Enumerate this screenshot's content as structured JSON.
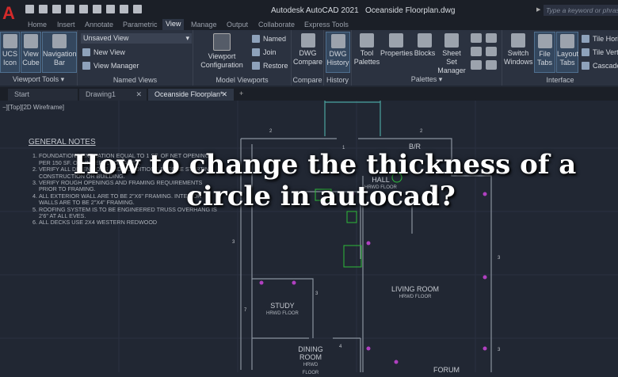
{
  "app": {
    "title": "Autodesk AutoCAD 2021",
    "file": "Oceanside Floorplan.dwg",
    "search_placeholder": "Type a keyword or phrase",
    "logo": "A"
  },
  "menu_tabs": [
    "Home",
    "Insert",
    "Annotate",
    "Parametric",
    "View",
    "Manage",
    "Output",
    "Collaborate",
    "Express Tools"
  ],
  "active_tab": "View",
  "ribbon": {
    "viewport_tools": {
      "label": "Viewport Tools ▾",
      "ucs": "UCS Icon",
      "cube": "View Cube",
      "nav": "Navigation Bar"
    },
    "named_views": {
      "label": "Named Views",
      "dropdown": "Unsaved View",
      "new_view": "New View",
      "view_manager": "View Manager"
    },
    "model_viewports": {
      "label": "Model Viewports",
      "config": "Viewport Configuration",
      "named": "Named",
      "join": "Join",
      "restore": "Restore"
    },
    "compare": {
      "label": "Compare",
      "btn": "DWG Compare"
    },
    "history": {
      "label": "History",
      "btn": "DWG History"
    },
    "palettes": {
      "label": "Palettes ▾",
      "tool": "Tool Palettes",
      "properties": "Properties",
      "blocks": "Blocks",
      "sheetset": "Sheet Set Manager"
    },
    "interface": {
      "label": "Interface",
      "switch": "Switch Windows",
      "file_tabs": "File Tabs",
      "layout_tabs": "Layout Tabs",
      "tile_h": "Tile Horizontally",
      "tile_v": "Tile Vertically",
      "cascade": "Cascade"
    }
  },
  "file_tabs": [
    "Start",
    "Drawing1",
    "Oceanside Floorplan*"
  ],
  "viewport_label": "−][Top][2D Wireframe]",
  "notes": {
    "title": "GENERAL NOTES",
    "items": [
      "FOUNDATION VENTILATION EQUAL TO 1 SF. OF NET OPENING PER 150 SF. OF UNDERFLOOR AREA.",
      "VERIFY ALL DIMENSIONS AND CONDITIONS BEFORE STARTING CONSTRUCTION OR BUILDING.",
      "VERIFY ROUGH OPENINGS AND FRAMING REQUIREMENTS PRIOR TO FRAMING.",
      "ALL EXTERIOR WALL ARE TO BE 2\"X6\" FRAMING. INTERIOR WALLS ARE TO BE 2\"X4\" FRAMING.",
      "ROOFING SYSTEM IS TO BE ENGINEERED TRUSS OVERHANG IS 2'6\" AT ALL EVES.",
      "ALL DECKS USE 2X4 WESTERN REDWOOD"
    ]
  },
  "rooms": {
    "br": "B/R",
    "hall": "HALL",
    "hall_floor": "HRWD FLOOR",
    "living": "LIVING ROOM",
    "living_floor": "HRWD FLOOR",
    "study": "STUDY",
    "study_floor": "HRWD FLOOR",
    "dining": "DINING ROOM",
    "dining_floor": "HRWD FLOOR",
    "forum": "FORUM"
  },
  "headline": {
    "line1": "How to change the thickness of a",
    "line2": "circle in autocad?"
  }
}
